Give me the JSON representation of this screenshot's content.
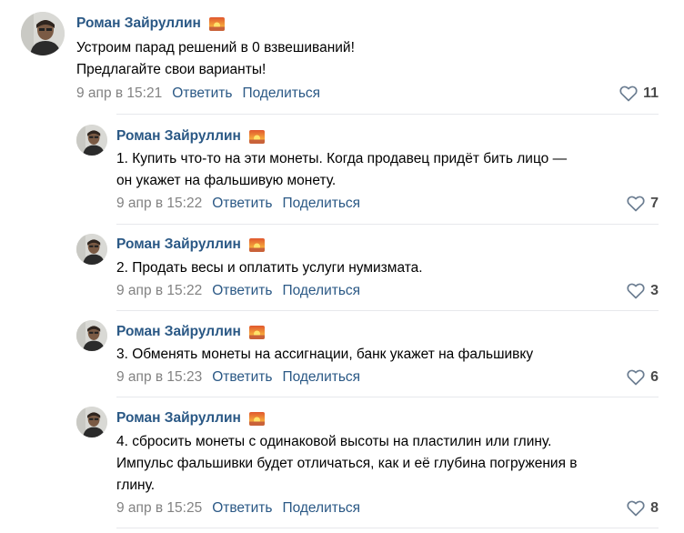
{
  "colors": {
    "author": "#2a5885",
    "link": "#2a5885",
    "date": "#828282",
    "text": "#000000",
    "divider": "#e7e8ec"
  },
  "icons": {
    "badge": "sunset-emoji-icon",
    "like": "heart-icon"
  },
  "comments": [
    {
      "author": "Роман Зайруллин",
      "text": "Устроим парад решений в 0 взвешиваний!\nПредлагайте свои варианты!",
      "date": "9 апр в 15:21",
      "reply": "Ответить",
      "share": "Поделиться",
      "likes": "11"
    },
    {
      "author": "Роман Зайруллин",
      "text": "1. Купить что-то на эти монеты. Когда продавец придёт бить лицо —\nон укажет на фальшивую монету.",
      "date": "9 апр в 15:22",
      "reply": "Ответить",
      "share": "Поделиться",
      "likes": "7"
    },
    {
      "author": "Роман Зайруллин",
      "text": "2. Продать весы и оплатить услуги нумизмата.",
      "date": "9 апр в 15:22",
      "reply": "Ответить",
      "share": "Поделиться",
      "likes": "3"
    },
    {
      "author": "Роман Зайруллин",
      "text": "3. Обменять монеты на ассигнации, банк укажет на фальшивку",
      "date": "9 апр в 15:23",
      "reply": "Ответить",
      "share": "Поделиться",
      "likes": "6"
    },
    {
      "author": "Роман Зайруллин",
      "text": "4. сбросить монеты с одинаковой высоты на пластилин или глину.\nИмпульс фальшивки будет отличаться, как и её глубина погружения в\nглину.",
      "date": "9 апр в 15:25",
      "reply": "Ответить",
      "share": "Поделиться",
      "likes": "8"
    }
  ]
}
